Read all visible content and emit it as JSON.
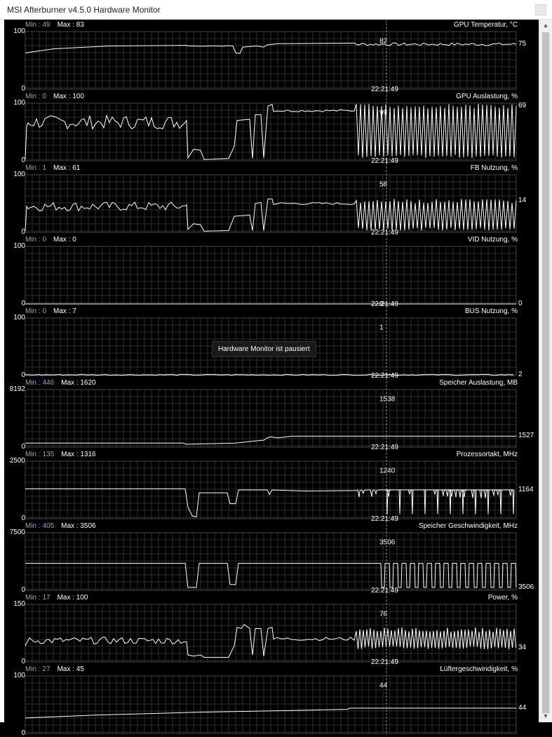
{
  "window": {
    "title": "MSI Afterburner v4.5.0 Hardware Monitor"
  },
  "overlay": {
    "paused_text": "Hardware Monitor ist pausiert"
  },
  "colors": {
    "background": "#000000",
    "grid": "#2e2e2e",
    "line": "#ffffff",
    "cursor": "#a09060",
    "min_label": "#8aa7c8"
  },
  "panels": [
    {
      "title": "GPU Temperatur, °C",
      "min_label": "Min : 49",
      "max_label": "Max : 83",
      "ymax": "100",
      "ymin": "0",
      "current": "75",
      "cursor_value": "82",
      "cursor_time": "22:21:49"
    },
    {
      "title": "GPU Auslastung, %",
      "min_label": "Min : 0",
      "max_label": "Max : 100",
      "ymax": "100",
      "ymin": "0",
      "current": "69",
      "cursor_value": "99",
      "cursor_time": "22:21:49"
    },
    {
      "title": "FB Nutzung, %",
      "min_label": "Min : 1",
      "max_label": "Max : 61",
      "ymax": "100",
      "ymin": "0",
      "current": "14",
      "cursor_value": "58",
      "cursor_time": "22:21:49"
    },
    {
      "title": "VID Nutzung, %",
      "min_label": "Min : 0",
      "max_label": "Max : 0",
      "ymax": "100",
      "ymin": "0",
      "current": "0",
      "cursor_value": "0",
      "cursor_time": "22:21:49"
    },
    {
      "title": "BUS Nutzung, %",
      "min_label": "Min : 0",
      "max_label": "Max : 7",
      "ymax": "100",
      "ymin": "0",
      "current": "2",
      "cursor_value": "1",
      "cursor_time": "22:21:49"
    },
    {
      "title": "Speicher Auslastung, MB",
      "min_label": "Min : 446",
      "max_label": "Max : 1620",
      "ymax": "8192",
      "ymin": "0",
      "current": "1527",
      "cursor_value": "1538",
      "cursor_time": "22:21:49"
    },
    {
      "title": "Prozessortakt, MHz",
      "min_label": "Min : 135",
      "max_label": "Max : 1316",
      "ymax": "2500",
      "ymin": "0",
      "current": "1164",
      "cursor_value": "1240",
      "cursor_time": "22:21:49"
    },
    {
      "title": "Speicher Geschwindigkeit, MHz",
      "min_label": "Min : 405",
      "max_label": "Max : 3506",
      "ymax": "7500",
      "ymin": "0",
      "current": "3506",
      "cursor_value": "3506",
      "cursor_time": "22:21:49"
    },
    {
      "title": "Power, %",
      "min_label": "Min : 17",
      "max_label": "Max : 100",
      "ymax": "150",
      "ymin": "0",
      "current": "34",
      "cursor_value": "76",
      "cursor_time": "22:21:49"
    },
    {
      "title": "Lüftergeschwindigkeit, %",
      "min_label": "Min : 27",
      "max_label": "Max : 45",
      "ymax": "100",
      "ymin": "0",
      "current": "44",
      "cursor_value": "44",
      "cursor_time": ""
    }
  ]
}
